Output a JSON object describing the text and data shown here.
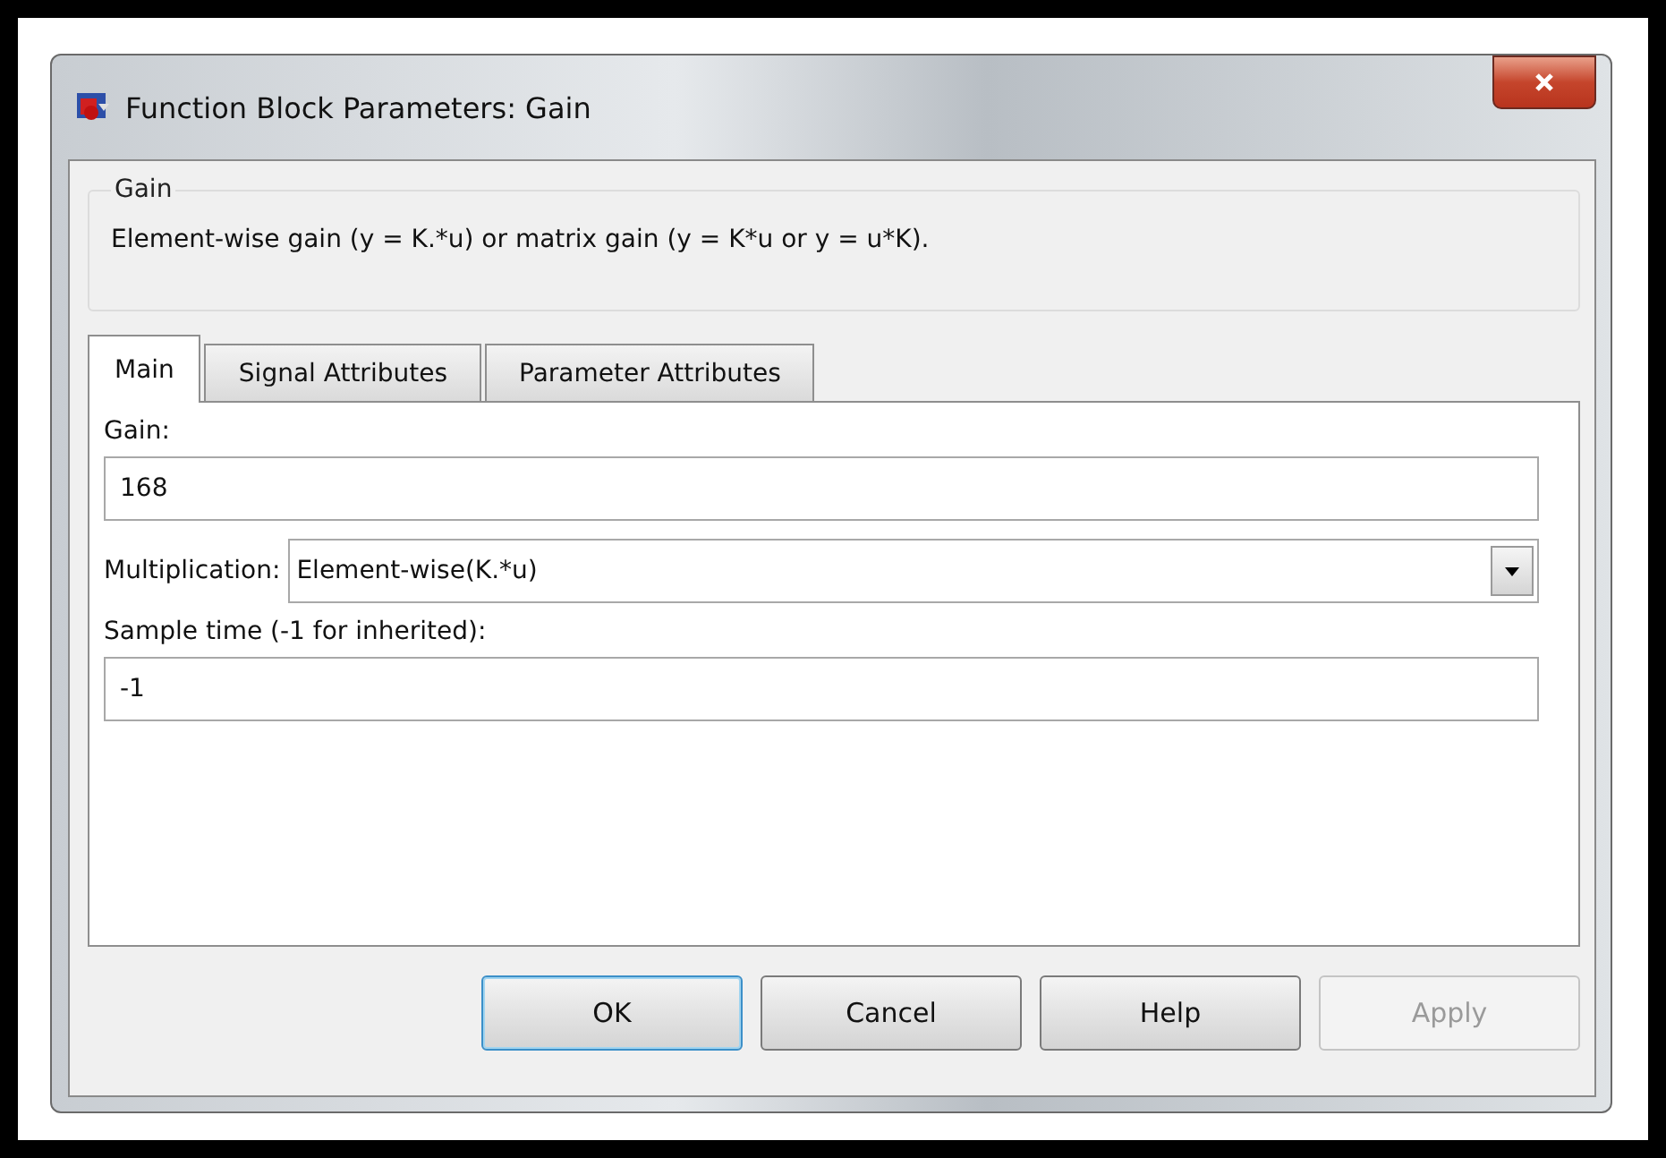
{
  "window": {
    "title": "Function Block Parameters: Gain"
  },
  "group": {
    "title": "Gain",
    "description": "Element-wise gain (y = K.*u) or matrix gain (y = K*u or y = u*K)."
  },
  "tabs": [
    {
      "label": "Main",
      "selected": true
    },
    {
      "label": "Signal Attributes",
      "selected": false
    },
    {
      "label": "Parameter Attributes",
      "selected": false
    }
  ],
  "fields": [
    {
      "kind": "text",
      "label": "Gain:",
      "value": "168"
    },
    {
      "kind": "dropdown",
      "label": "Multiplication:",
      "value": "Element-wise(K.*u)"
    },
    {
      "kind": "text",
      "label": "Sample time (-1 for inherited):",
      "value": "-1"
    }
  ],
  "buttons": [
    {
      "label": "OK",
      "default": true,
      "disabled": false
    },
    {
      "label": "Cancel",
      "default": false,
      "disabled": false
    },
    {
      "label": "Help",
      "default": false,
      "disabled": false
    },
    {
      "label": "Apply",
      "default": false,
      "disabled": true
    }
  ]
}
